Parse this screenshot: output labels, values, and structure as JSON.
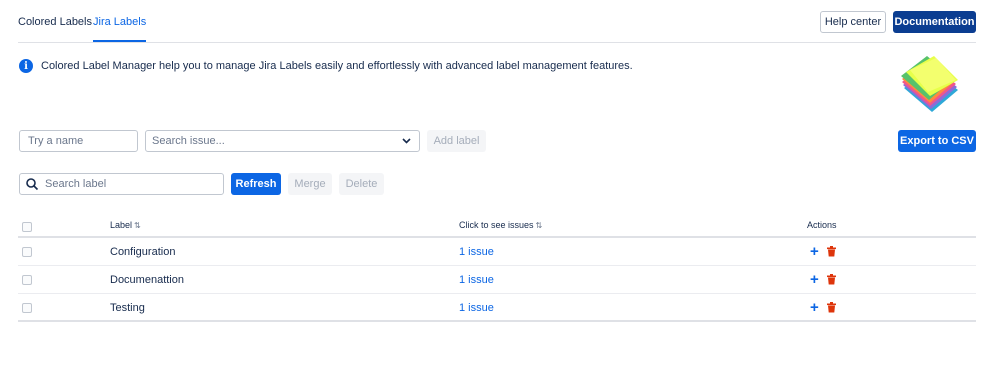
{
  "tabs": [
    {
      "label": "Colored Labels",
      "active": false
    },
    {
      "label": "Jira Labels",
      "active": true
    }
  ],
  "header": {
    "help_label": "Help center",
    "docs_label": "Documentation"
  },
  "info": {
    "icon": "info-icon",
    "text": "Colored Label Manager help you to manage Jira Labels easily and effortlessly with advanced label management features."
  },
  "add_form": {
    "name_placeholder": "Try a name",
    "issue_placeholder": "Search issue...",
    "add_label": "Add label",
    "export_label": "Export to CSV"
  },
  "toolbar": {
    "search_placeholder": "Search label",
    "refresh_label": "Refresh",
    "merge_label": "Merge",
    "delete_label": "Delete"
  },
  "table": {
    "columns": {
      "label": "Label",
      "issues": "Click to see issues",
      "actions": "Actions"
    },
    "rows": [
      {
        "label": "Configuration",
        "issues": "1 issue"
      },
      {
        "label": "Documenattion",
        "issues": "1 issue"
      },
      {
        "label": "Testing",
        "issues": "1 issue"
      }
    ]
  },
  "colors": {
    "primary": "#0c66e4",
    "docs_button": "#0b3d91",
    "delete_icon": "#de350b",
    "disabled_bg": "#f4f5f7",
    "disabled_text": "#a5adba"
  }
}
